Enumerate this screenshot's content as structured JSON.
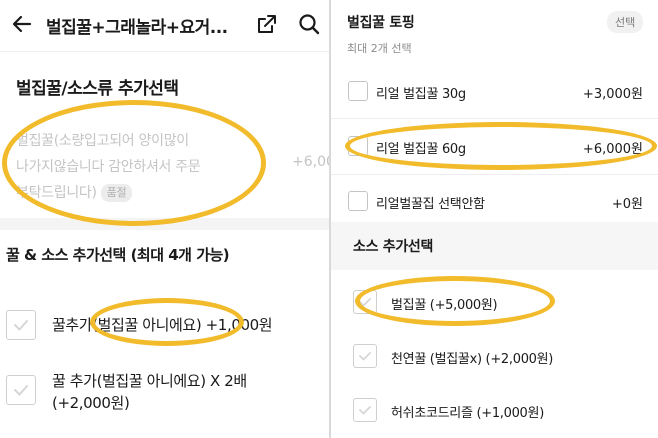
{
  "left": {
    "header": {
      "title": "벌집꿀+그래놀라+요거..."
    },
    "section1": {
      "title": "벌집꿀/소스류 추가선택",
      "disabled_option": {
        "line1": "벌집꿀(소량입고되어 양이많이",
        "line2": "나가지않습니다 감안하셔서 주문",
        "line3": "부탁드립니다)",
        "badge": "품절",
        "price": "+6,00"
      }
    },
    "section2": {
      "title": "꿀 & 소스 추가선택 (최대 4개 가능)",
      "options": [
        {
          "label": "꿀추가(벌집꿀 아니에요) +1,000원"
        },
        {
          "line1": "꿀 추가(벌집꿀 아니에요) X 2배",
          "line2": "(+2,000원)"
        }
      ]
    }
  },
  "right": {
    "section1": {
      "title": "벌집꿀 토핑",
      "badge": "선택",
      "subtitle": "최대 2개 선택",
      "options": [
        {
          "label": "리얼 벌집꿀 30g",
          "price": "+3,000원"
        },
        {
          "label": "리얼 벌집꿀 60g",
          "price": "+6,000원"
        },
        {
          "label": "리얼벌꿀집 선택안함",
          "price": "+0원"
        }
      ]
    },
    "section2": {
      "title": "소스 추가선택",
      "options": [
        {
          "label": "벌집꿀 (+5,000원)"
        },
        {
          "label": "천연꿀 (벌집꿀x) (+2,000원)"
        },
        {
          "label": "허쉬초코드리즐 (+1,000원)"
        }
      ]
    }
  },
  "icons": {
    "back": "arrow-left-icon",
    "share": "share-icon",
    "search": "search-icon",
    "checkbox": "checkmark-icon"
  },
  "colors": {
    "highlight": "#f2bb2c",
    "disabled_text": "#c4c4c4",
    "divider": "#eeeeee"
  }
}
